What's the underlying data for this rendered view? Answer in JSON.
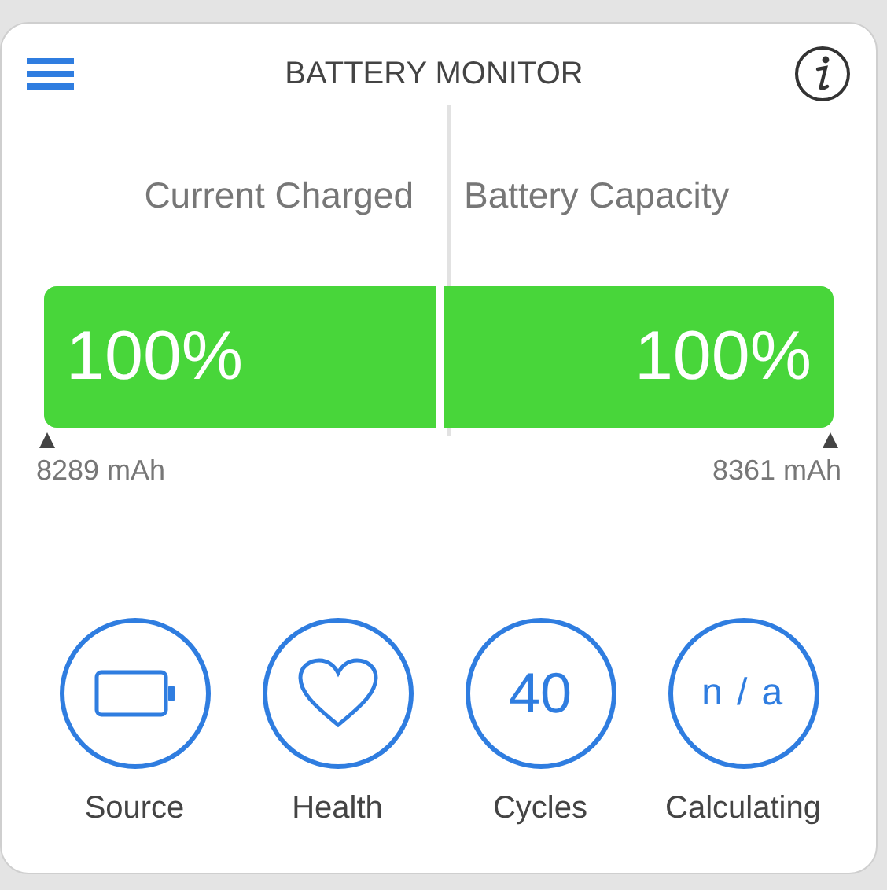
{
  "window": {
    "title": "BATTERY MONITOR"
  },
  "gauges": [
    {
      "label": "Current Charged",
      "level": 1,
      "reading": "100%",
      "capacity": "8289 mAh"
    },
    {
      "label": "Battery Capacity",
      "level": 1,
      "reading": "100%",
      "capacity": "8361 mAh"
    }
  ],
  "stats": [
    {
      "kind": "battery",
      "label": "Source"
    },
    {
      "kind": "heart",
      "label": "Health"
    },
    {
      "kind": "text",
      "value": "40",
      "label": "Cycles"
    },
    {
      "kind": "text",
      "value": "n / a",
      "label": "Calculating"
    }
  ]
}
